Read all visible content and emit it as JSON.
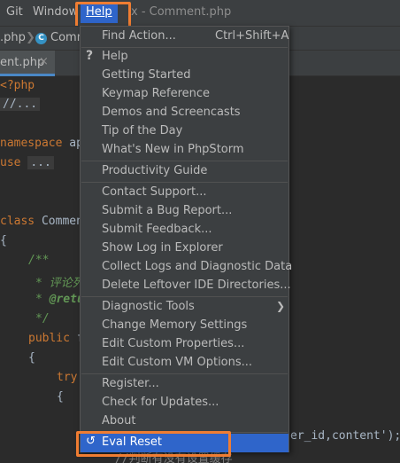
{
  "menubar": {
    "git": "Git",
    "window": "Window",
    "help": "Help",
    "title_fragment": "x - Comment.php"
  },
  "breadcrumb": {
    "file": ".php",
    "class_icon": "C",
    "class_name": "Comm"
  },
  "tabs": [
    {
      "label": "ent.php",
      "close": "×"
    }
  ],
  "editor": {
    "lines": {
      "php_open": "<?php",
      "fold1": "//...",
      "ns_kw": "namespace",
      "ns_tail": " ap",
      "use_kw": "use",
      "use_fold": "...",
      "class_kw": "class",
      "class_name": " Commen",
      "brace_open": "{",
      "doc_open": "/**",
      "doc_line1_star": "* ",
      "doc_line1_text": "评论列",
      "doc_line2_star": "* ",
      "doc_line2_tag": "@retu",
      "doc_close": "*/",
      "public_kw": "public",
      "public_tail": " f",
      "brace2": "{",
      "try_kw": "try",
      "brace3": "{",
      "insert_tail": "er_id,content');",
      "last_comment": "//判断有没有设置缓存"
    }
  },
  "menu": {
    "find_action": "Find Action...",
    "find_action_shortcut": "Ctrl+Shift+A",
    "help_icon": "?",
    "help": "Help",
    "getting_started": "Getting Started",
    "keymap_reference": "Keymap Reference",
    "demos": "Demos and Screencasts",
    "tip_of_day": "Tip of the Day",
    "whats_new": "What's New in PhpStorm",
    "productivity_guide": "Productivity Guide",
    "contact_support": "Contact Support...",
    "submit_bug": "Submit a Bug Report...",
    "submit_feedback": "Submit Feedback...",
    "show_log": "Show Log in Explorer",
    "collect_logs": "Collect Logs and Diagnostic Data",
    "delete_leftover": "Delete Leftover IDE Directories...",
    "diagnostic_tools": "Diagnostic Tools",
    "change_memory": "Change Memory Settings",
    "edit_props": "Edit Custom Properties...",
    "edit_vm": "Edit Custom VM Options...",
    "register": "Register...",
    "check_updates": "Check for Updates...",
    "about": "About",
    "eval_reset": "Eval Reset"
  },
  "colors": {
    "accent_highlight": "#ef7d32",
    "selection": "#2f65ca",
    "menu_bg": "#3c3f41",
    "editor_bg": "#2b2b2b"
  }
}
